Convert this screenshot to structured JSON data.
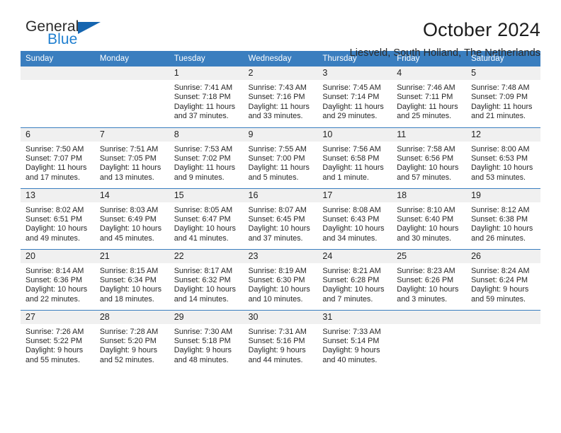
{
  "brand": {
    "name_line1": "General",
    "name_line2": "Blue",
    "triangle_color": "#1565b0",
    "blue_text_color": "#1f7fd0"
  },
  "header": {
    "title": "October 2024",
    "subtitle": "Liesveld, South Holland, The Netherlands",
    "header_bg_color": "#3a7ebf",
    "daynum_bg_color": "#f0f0f0"
  },
  "weekdays": [
    "Sunday",
    "Monday",
    "Tuesday",
    "Wednesday",
    "Thursday",
    "Friday",
    "Saturday"
  ],
  "labels": {
    "sunrise_prefix": "Sunrise:",
    "sunset_prefix": "Sunset:",
    "daylight_prefix": "Daylight:"
  },
  "weeks": [
    [
      {
        "day": "",
        "blank": true
      },
      {
        "day": "",
        "blank": true
      },
      {
        "day": "1",
        "sunrise": "Sunrise: 7:41 AM",
        "sunset": "Sunset: 7:18 PM",
        "daylight_1": "Daylight: 11 hours",
        "daylight_2": "and 37 minutes."
      },
      {
        "day": "2",
        "sunrise": "Sunrise: 7:43 AM",
        "sunset": "Sunset: 7:16 PM",
        "daylight_1": "Daylight: 11 hours",
        "daylight_2": "and 33 minutes."
      },
      {
        "day": "3",
        "sunrise": "Sunrise: 7:45 AM",
        "sunset": "Sunset: 7:14 PM",
        "daylight_1": "Daylight: 11 hours",
        "daylight_2": "and 29 minutes."
      },
      {
        "day": "4",
        "sunrise": "Sunrise: 7:46 AM",
        "sunset": "Sunset: 7:11 PM",
        "daylight_1": "Daylight: 11 hours",
        "daylight_2": "and 25 minutes."
      },
      {
        "day": "5",
        "sunrise": "Sunrise: 7:48 AM",
        "sunset": "Sunset: 7:09 PM",
        "daylight_1": "Daylight: 11 hours",
        "daylight_2": "and 21 minutes."
      }
    ],
    [
      {
        "day": "6",
        "sunrise": "Sunrise: 7:50 AM",
        "sunset": "Sunset: 7:07 PM",
        "daylight_1": "Daylight: 11 hours",
        "daylight_2": "and 17 minutes."
      },
      {
        "day": "7",
        "sunrise": "Sunrise: 7:51 AM",
        "sunset": "Sunset: 7:05 PM",
        "daylight_1": "Daylight: 11 hours",
        "daylight_2": "and 13 minutes."
      },
      {
        "day": "8",
        "sunrise": "Sunrise: 7:53 AM",
        "sunset": "Sunset: 7:02 PM",
        "daylight_1": "Daylight: 11 hours",
        "daylight_2": "and 9 minutes."
      },
      {
        "day": "9",
        "sunrise": "Sunrise: 7:55 AM",
        "sunset": "Sunset: 7:00 PM",
        "daylight_1": "Daylight: 11 hours",
        "daylight_2": "and 5 minutes."
      },
      {
        "day": "10",
        "sunrise": "Sunrise: 7:56 AM",
        "sunset": "Sunset: 6:58 PM",
        "daylight_1": "Daylight: 11 hours",
        "daylight_2": "and 1 minute."
      },
      {
        "day": "11",
        "sunrise": "Sunrise: 7:58 AM",
        "sunset": "Sunset: 6:56 PM",
        "daylight_1": "Daylight: 10 hours",
        "daylight_2": "and 57 minutes."
      },
      {
        "day": "12",
        "sunrise": "Sunrise: 8:00 AM",
        "sunset": "Sunset: 6:53 PM",
        "daylight_1": "Daylight: 10 hours",
        "daylight_2": "and 53 minutes."
      }
    ],
    [
      {
        "day": "13",
        "sunrise": "Sunrise: 8:02 AM",
        "sunset": "Sunset: 6:51 PM",
        "daylight_1": "Daylight: 10 hours",
        "daylight_2": "and 49 minutes."
      },
      {
        "day": "14",
        "sunrise": "Sunrise: 8:03 AM",
        "sunset": "Sunset: 6:49 PM",
        "daylight_1": "Daylight: 10 hours",
        "daylight_2": "and 45 minutes."
      },
      {
        "day": "15",
        "sunrise": "Sunrise: 8:05 AM",
        "sunset": "Sunset: 6:47 PM",
        "daylight_1": "Daylight: 10 hours",
        "daylight_2": "and 41 minutes."
      },
      {
        "day": "16",
        "sunrise": "Sunrise: 8:07 AM",
        "sunset": "Sunset: 6:45 PM",
        "daylight_1": "Daylight: 10 hours",
        "daylight_2": "and 37 minutes."
      },
      {
        "day": "17",
        "sunrise": "Sunrise: 8:08 AM",
        "sunset": "Sunset: 6:43 PM",
        "daylight_1": "Daylight: 10 hours",
        "daylight_2": "and 34 minutes."
      },
      {
        "day": "18",
        "sunrise": "Sunrise: 8:10 AM",
        "sunset": "Sunset: 6:40 PM",
        "daylight_1": "Daylight: 10 hours",
        "daylight_2": "and 30 minutes."
      },
      {
        "day": "19",
        "sunrise": "Sunrise: 8:12 AM",
        "sunset": "Sunset: 6:38 PM",
        "daylight_1": "Daylight: 10 hours",
        "daylight_2": "and 26 minutes."
      }
    ],
    [
      {
        "day": "20",
        "sunrise": "Sunrise: 8:14 AM",
        "sunset": "Sunset: 6:36 PM",
        "daylight_1": "Daylight: 10 hours",
        "daylight_2": "and 22 minutes."
      },
      {
        "day": "21",
        "sunrise": "Sunrise: 8:15 AM",
        "sunset": "Sunset: 6:34 PM",
        "daylight_1": "Daylight: 10 hours",
        "daylight_2": "and 18 minutes."
      },
      {
        "day": "22",
        "sunrise": "Sunrise: 8:17 AM",
        "sunset": "Sunset: 6:32 PM",
        "daylight_1": "Daylight: 10 hours",
        "daylight_2": "and 14 minutes."
      },
      {
        "day": "23",
        "sunrise": "Sunrise: 8:19 AM",
        "sunset": "Sunset: 6:30 PM",
        "daylight_1": "Daylight: 10 hours",
        "daylight_2": "and 10 minutes."
      },
      {
        "day": "24",
        "sunrise": "Sunrise: 8:21 AM",
        "sunset": "Sunset: 6:28 PM",
        "daylight_1": "Daylight: 10 hours",
        "daylight_2": "and 7 minutes."
      },
      {
        "day": "25",
        "sunrise": "Sunrise: 8:23 AM",
        "sunset": "Sunset: 6:26 PM",
        "daylight_1": "Daylight: 10 hours",
        "daylight_2": "and 3 minutes."
      },
      {
        "day": "26",
        "sunrise": "Sunrise: 8:24 AM",
        "sunset": "Sunset: 6:24 PM",
        "daylight_1": "Daylight: 9 hours",
        "daylight_2": "and 59 minutes."
      }
    ],
    [
      {
        "day": "27",
        "sunrise": "Sunrise: 7:26 AM",
        "sunset": "Sunset: 5:22 PM",
        "daylight_1": "Daylight: 9 hours",
        "daylight_2": "and 55 minutes."
      },
      {
        "day": "28",
        "sunrise": "Sunrise: 7:28 AM",
        "sunset": "Sunset: 5:20 PM",
        "daylight_1": "Daylight: 9 hours",
        "daylight_2": "and 52 minutes."
      },
      {
        "day": "29",
        "sunrise": "Sunrise: 7:30 AM",
        "sunset": "Sunset: 5:18 PM",
        "daylight_1": "Daylight: 9 hours",
        "daylight_2": "and 48 minutes."
      },
      {
        "day": "30",
        "sunrise": "Sunrise: 7:31 AM",
        "sunset": "Sunset: 5:16 PM",
        "daylight_1": "Daylight: 9 hours",
        "daylight_2": "and 44 minutes."
      },
      {
        "day": "31",
        "sunrise": "Sunrise: 7:33 AM",
        "sunset": "Sunset: 5:14 PM",
        "daylight_1": "Daylight: 9 hours",
        "daylight_2": "and 40 minutes."
      },
      {
        "day": "",
        "blank": true
      },
      {
        "day": "",
        "blank": true
      }
    ]
  ]
}
